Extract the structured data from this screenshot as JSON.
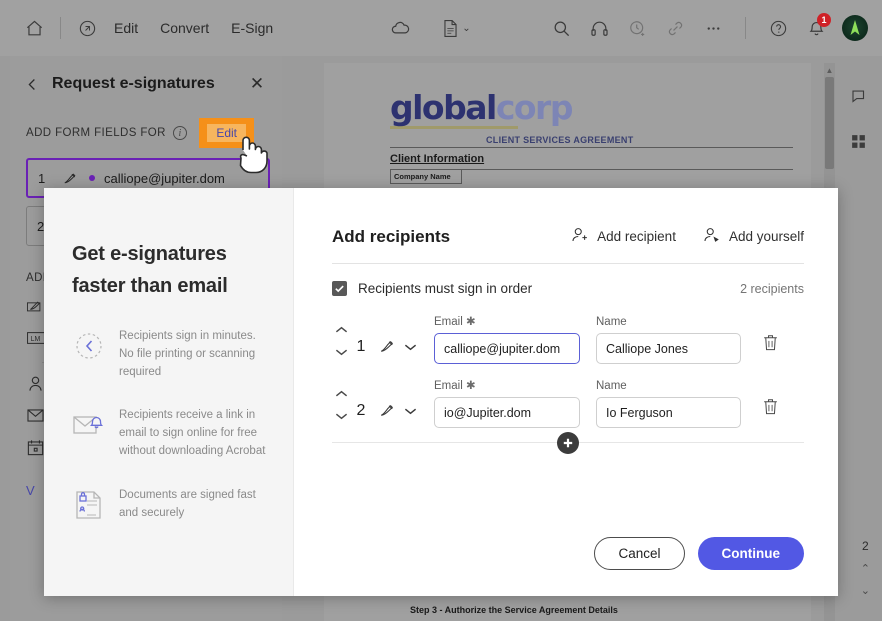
{
  "toolbar": {
    "home_icon": "home-icon",
    "tools_icon": "tools-icon",
    "menu": [
      {
        "label": "Edit"
      },
      {
        "label": "Convert"
      },
      {
        "label": "E-Sign"
      }
    ],
    "cloud_icon": "cloud-icon",
    "page_icon": "page-view-icon",
    "page_chevron": "⌄",
    "search_icon": "search-icon",
    "headphones_icon": "headphones-icon",
    "stamp_icon": "stamp-icon",
    "link_icon": "link-icon",
    "more_icon": "more-options-icon",
    "help_icon": "help-icon",
    "bell_icon": "notifications-icon",
    "notification_count": "1",
    "avatar": "user-avatar"
  },
  "left_panel": {
    "back_icon": "back-chevron-icon",
    "title": "Request e-signatures",
    "close_icon": "✕",
    "fields_label": "ADD FORM FIELDS FOR",
    "info_icon": "i",
    "edit_label": "Edit",
    "recipients": [
      {
        "num": "1",
        "email": "calliope@jupiter.dom"
      },
      {
        "num": "2",
        "email": ""
      }
    ],
    "add_fields_label": "ADD",
    "tools": [
      "signature-field-icon",
      "initials-field-icon",
      "name-field-icon",
      "email-field-icon",
      "date-field-icon"
    ],
    "link_label": "V"
  },
  "document": {
    "logo_part1": "global",
    "logo_part2": "corp",
    "header_title": "CLIENT SERVICES AGREEMENT",
    "section_heading": "Client Information",
    "cell_label": "Company Name",
    "footer_text": "Step 3 - Authorize the Service Agreement Details",
    "page_number": "2",
    "rail": [
      "comment-icon",
      "thumbnail-grid-icon"
    ]
  },
  "dialog": {
    "promo": {
      "title_line1": "Get e-signatures",
      "title_line2": "faster than email",
      "items": [
        {
          "icon": "clock-icon",
          "text": "Recipients sign in minutes. No file printing or scanning required"
        },
        {
          "icon": "envelope-bell-icon",
          "text": "Recipients receive a link in email to sign online for free without downloading Acrobat"
        },
        {
          "icon": "lock-document-icon",
          "text": "Documents are signed fast and securely"
        }
      ]
    },
    "title": "Add recipients",
    "add_recipient_label": "Add recipient",
    "add_yourself_label": "Add yourself",
    "sign_in_order_label": "Recipients must sign in order",
    "sign_in_order_checked": true,
    "recipient_count_label": "2 recipients",
    "email_label": "Email",
    "email_required": "✱",
    "name_label": "Name",
    "rows": [
      {
        "num": "1",
        "email": "calliope@jupiter.dom",
        "name": "Calliope Jones",
        "focused": true
      },
      {
        "num": "2",
        "email": "io@Jupiter.dom",
        "name": "Io Ferguson",
        "focused": false
      }
    ],
    "add_row_icon": "add-recipient-plus-icon",
    "cancel_label": "Cancel",
    "continue_label": "Continue",
    "accent_color": "#5258e4"
  }
}
